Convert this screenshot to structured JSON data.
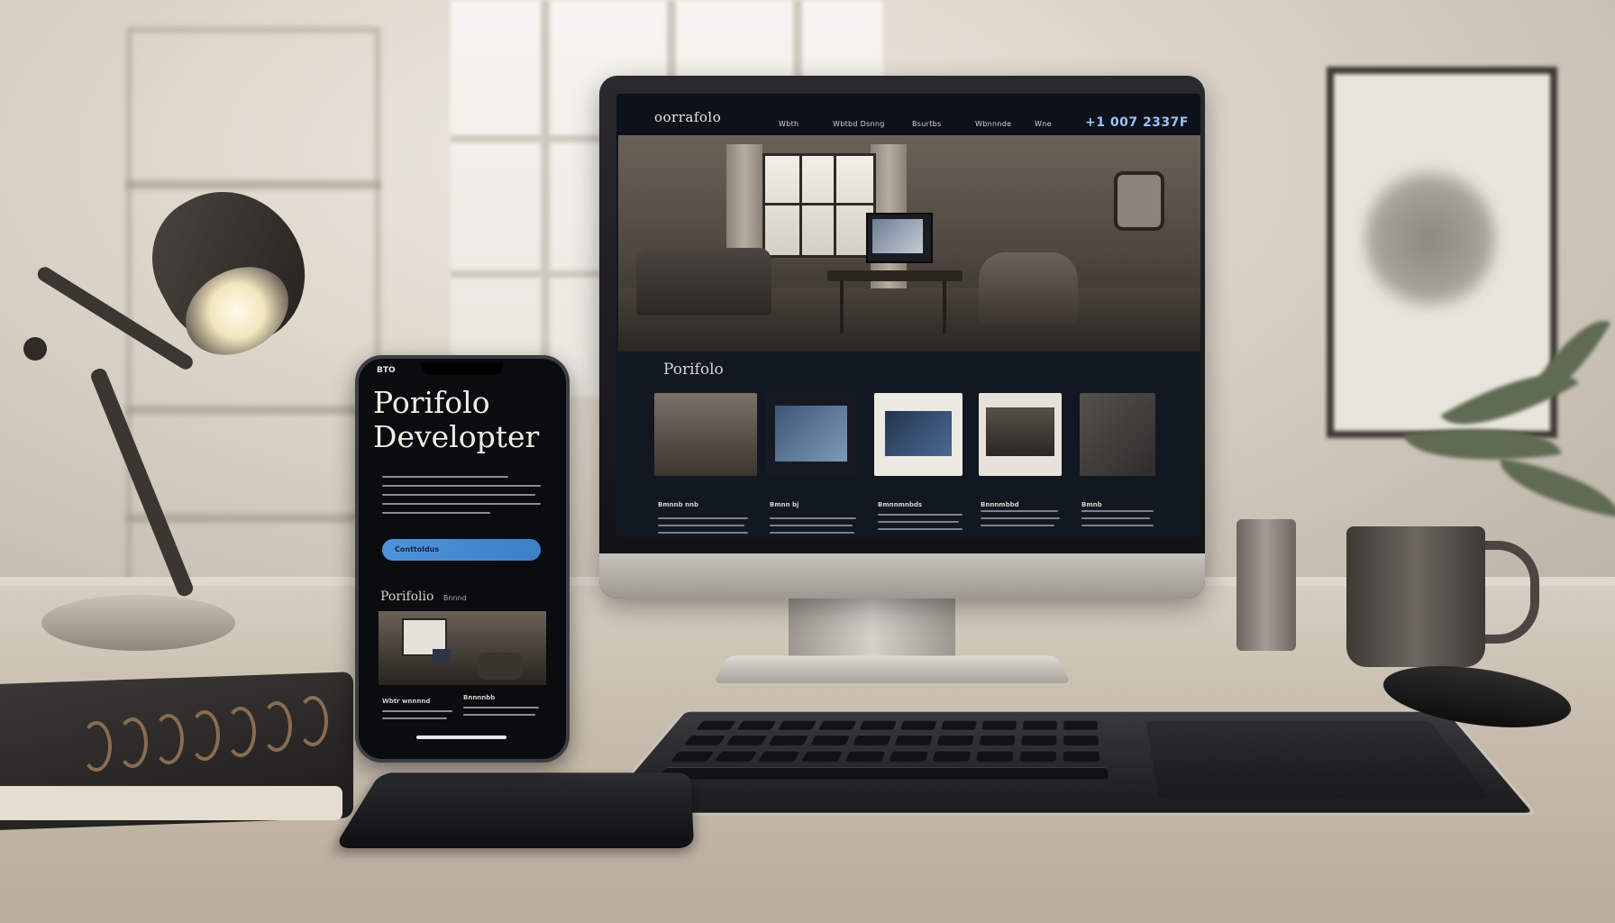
{
  "scene": {
    "description_objects": [
      "desk lamp",
      "notebook",
      "monitor",
      "smartphone",
      "keyboard",
      "cup",
      "mug",
      "mouse",
      "plant",
      "wall art"
    ]
  },
  "monitor_site": {
    "logo": "oorrafolo",
    "nav": [
      "Wbth",
      "Wbtbd Dsnng",
      "Bsurtbs",
      "Wbnnnde",
      "Wne"
    ],
    "phone": "+1 007 2337F",
    "section_title": "Porifolo",
    "thumbs": [
      {
        "caption": "Bmnnb nnb",
        "color": "#5b544c"
      },
      {
        "caption": "Bmnn bj",
        "color": "#2c3c55"
      },
      {
        "caption": "Bmnnmnbds",
        "color": "#e9e6e0"
      },
      {
        "caption": "Bnnnmbbd",
        "color": "#e6e2db"
      },
      {
        "caption": "Bmnb",
        "color": "#3d3a36"
      }
    ]
  },
  "phone_site": {
    "status": "BTO",
    "title_line1": "Porifolo",
    "title_line2": "Developter",
    "cta": "Conttoldus",
    "section_title": "Porifolio",
    "section_suffix": "Bnnnd",
    "captions": [
      "Wbtr wnnnnd",
      "Bnnnnbb"
    ]
  },
  "colors": {
    "accent_blue": "#4f93da",
    "phone_number_blue": "#9cc2f0",
    "screen_bg": "#121822"
  }
}
